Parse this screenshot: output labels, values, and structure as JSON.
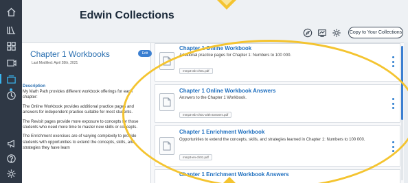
{
  "collection": {
    "title": "Edwin Collections"
  },
  "header": {
    "copy_button": "Copy to Your Collections",
    "icons": [
      "compass-icon",
      "slides-icon",
      "settings-icon"
    ]
  },
  "rail": {
    "items": [
      "home-icon",
      "library-icon",
      "grid-icon",
      "assign-icon",
      "collections-icon",
      "clock-icon",
      "megaphone-icon",
      "help-icon",
      "settings-icon"
    ]
  },
  "chapter": {
    "title": "Chapter 1 Workbooks",
    "edit_label": "Edit",
    "modified": "Last Modified: April 28th, 2021",
    "description_heading": "Description",
    "paragraphs": [
      "My Math Path provides different workbook offerings for each chapter:",
      "The Online Workbook provides additional practice pages and answers for independent practice suitable for most students.",
      "The Revisit pages provide more exposure to concepts for those students who need more time to master new skills or concepts.",
      "The Enrichment exercises are of varying complexity to provide students with opportunities to extend the concepts, skills, and strategies they have learn"
    ]
  },
  "cards": [
    {
      "title": "Chapter 1 Online Workbook",
      "desc": "Additional practice pages for Chapter 1: Numbers to 100 000.",
      "file": "mmp3-wb-ch01.pdf"
    },
    {
      "title": "Chapter 1 Online Workbook Answers",
      "desc": "Answers to the Chapter 1 Workbook.",
      "file": "mmp3-wb-ch01-with-answers.pdf"
    },
    {
      "title": "Chapter 1 Enrichment Workbook",
      "desc": "Opportunities to extend the concepts, skills, and strategies learned in Chapter 1: Numbers to 100 000.",
      "file": "mmp3-en-ch01.pdf"
    },
    {
      "title": "Chapter 1 Enrichment Workbook Answers",
      "desc": "",
      "file": ""
    }
  ],
  "colors": {
    "accent": "#2a6fb0",
    "highlight": "#f4c430",
    "rail": "#2f3845"
  }
}
